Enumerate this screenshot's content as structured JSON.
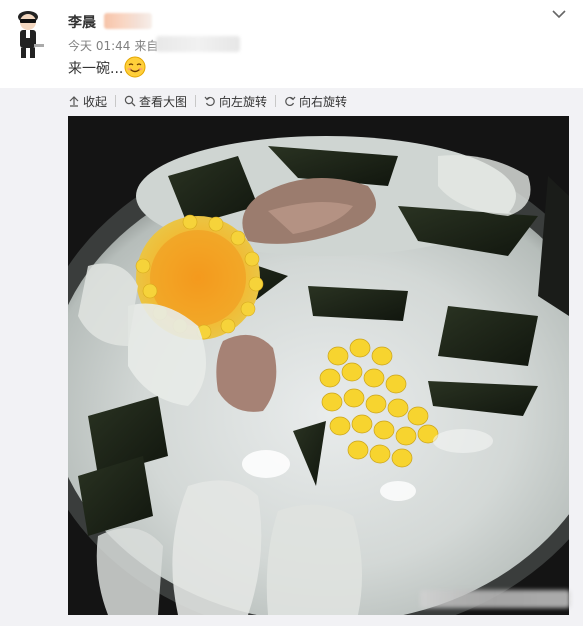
{
  "post": {
    "author": "李晨",
    "time": "今天 01:44",
    "source_prefix": "来自",
    "text": "来一碗..."
  },
  "toolbar": {
    "collapse": "收起",
    "view_large": "查看大图",
    "rotate_left": "向左旋转",
    "rotate_right": "向右旋转"
  },
  "icons": {
    "avatar": "avatar-cartoon",
    "emoji": "smiling-face",
    "chevron": "chevron-down-icon",
    "collapse": "arrow-up-icon",
    "zoom": "magnifier-icon",
    "rotate_left": "rotate-left-icon",
    "rotate_right": "rotate-right-icon"
  },
  "colors": {
    "toolbar_bg": "#f2f2f5",
    "text": "#333333",
    "meta": "#808080"
  }
}
